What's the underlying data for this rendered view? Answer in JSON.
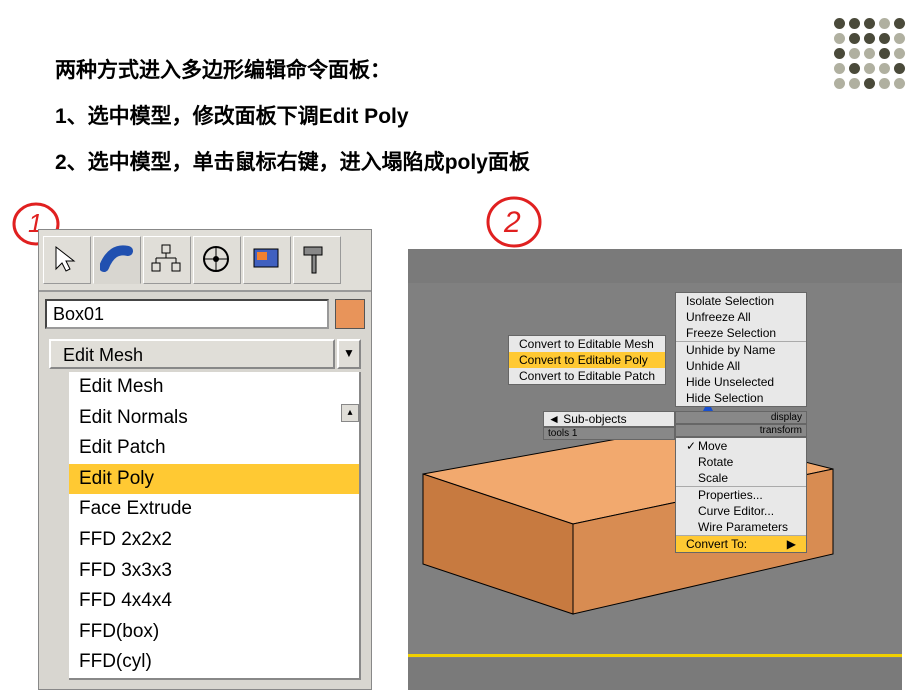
{
  "text": {
    "heading": "两种方式进入多边形编辑命令面板：",
    "line1_prefix": "1、选中模型，修改面板下调",
    "line1_bold": "Edit Poly",
    "line2_prefix": "2、选中模型，单击鼠标右键，进入塌陷成",
    "line2_bold": "poly面板"
  },
  "annotations": {
    "circle1": "1)",
    "circle2": "2"
  },
  "panel1": {
    "object_name": "Box01",
    "modifier_selected": "Edit Mesh",
    "list": [
      "Edit Mesh",
      "Edit Normals",
      "Edit Patch",
      "Edit Poly",
      "Face Extrude",
      "FFD 2x2x2",
      "FFD 3x3x3",
      "FFD 4x4x4",
      "FFD(box)",
      "FFD(cyl)"
    ],
    "selected_index": 3,
    "color_swatch": "#e8945a"
  },
  "panel2": {
    "top_menu": [
      "Isolate Selection",
      "Unfreeze All",
      "Freeze Selection",
      "Unhide by Name",
      "Unhide All",
      "Hide Unselected",
      "Hide Selection"
    ],
    "sub_objects_label": "Sub-objects",
    "sub_objects_arrow": "◄",
    "quad_labels": {
      "tools1": "tools 1",
      "display": "display",
      "transform": "transform"
    },
    "transform_menu": [
      {
        "label": "Move",
        "checked": true
      },
      {
        "label": "Rotate",
        "checked": false
      },
      {
        "label": "Scale",
        "checked": false
      },
      {
        "label": "Properties...",
        "checked": false
      },
      {
        "label": "Curve Editor...",
        "checked": false
      },
      {
        "label": "Wire Parameters",
        "checked": false
      },
      {
        "label": "Convert To:",
        "checked": false,
        "arrow": true,
        "selected": true
      }
    ],
    "convert_submenu": [
      {
        "label": "Convert to Editable Mesh",
        "selected": false
      },
      {
        "label": "Convert to Editable Poly",
        "selected": true
      },
      {
        "label": "Convert to Editable Patch",
        "selected": false
      }
    ]
  }
}
